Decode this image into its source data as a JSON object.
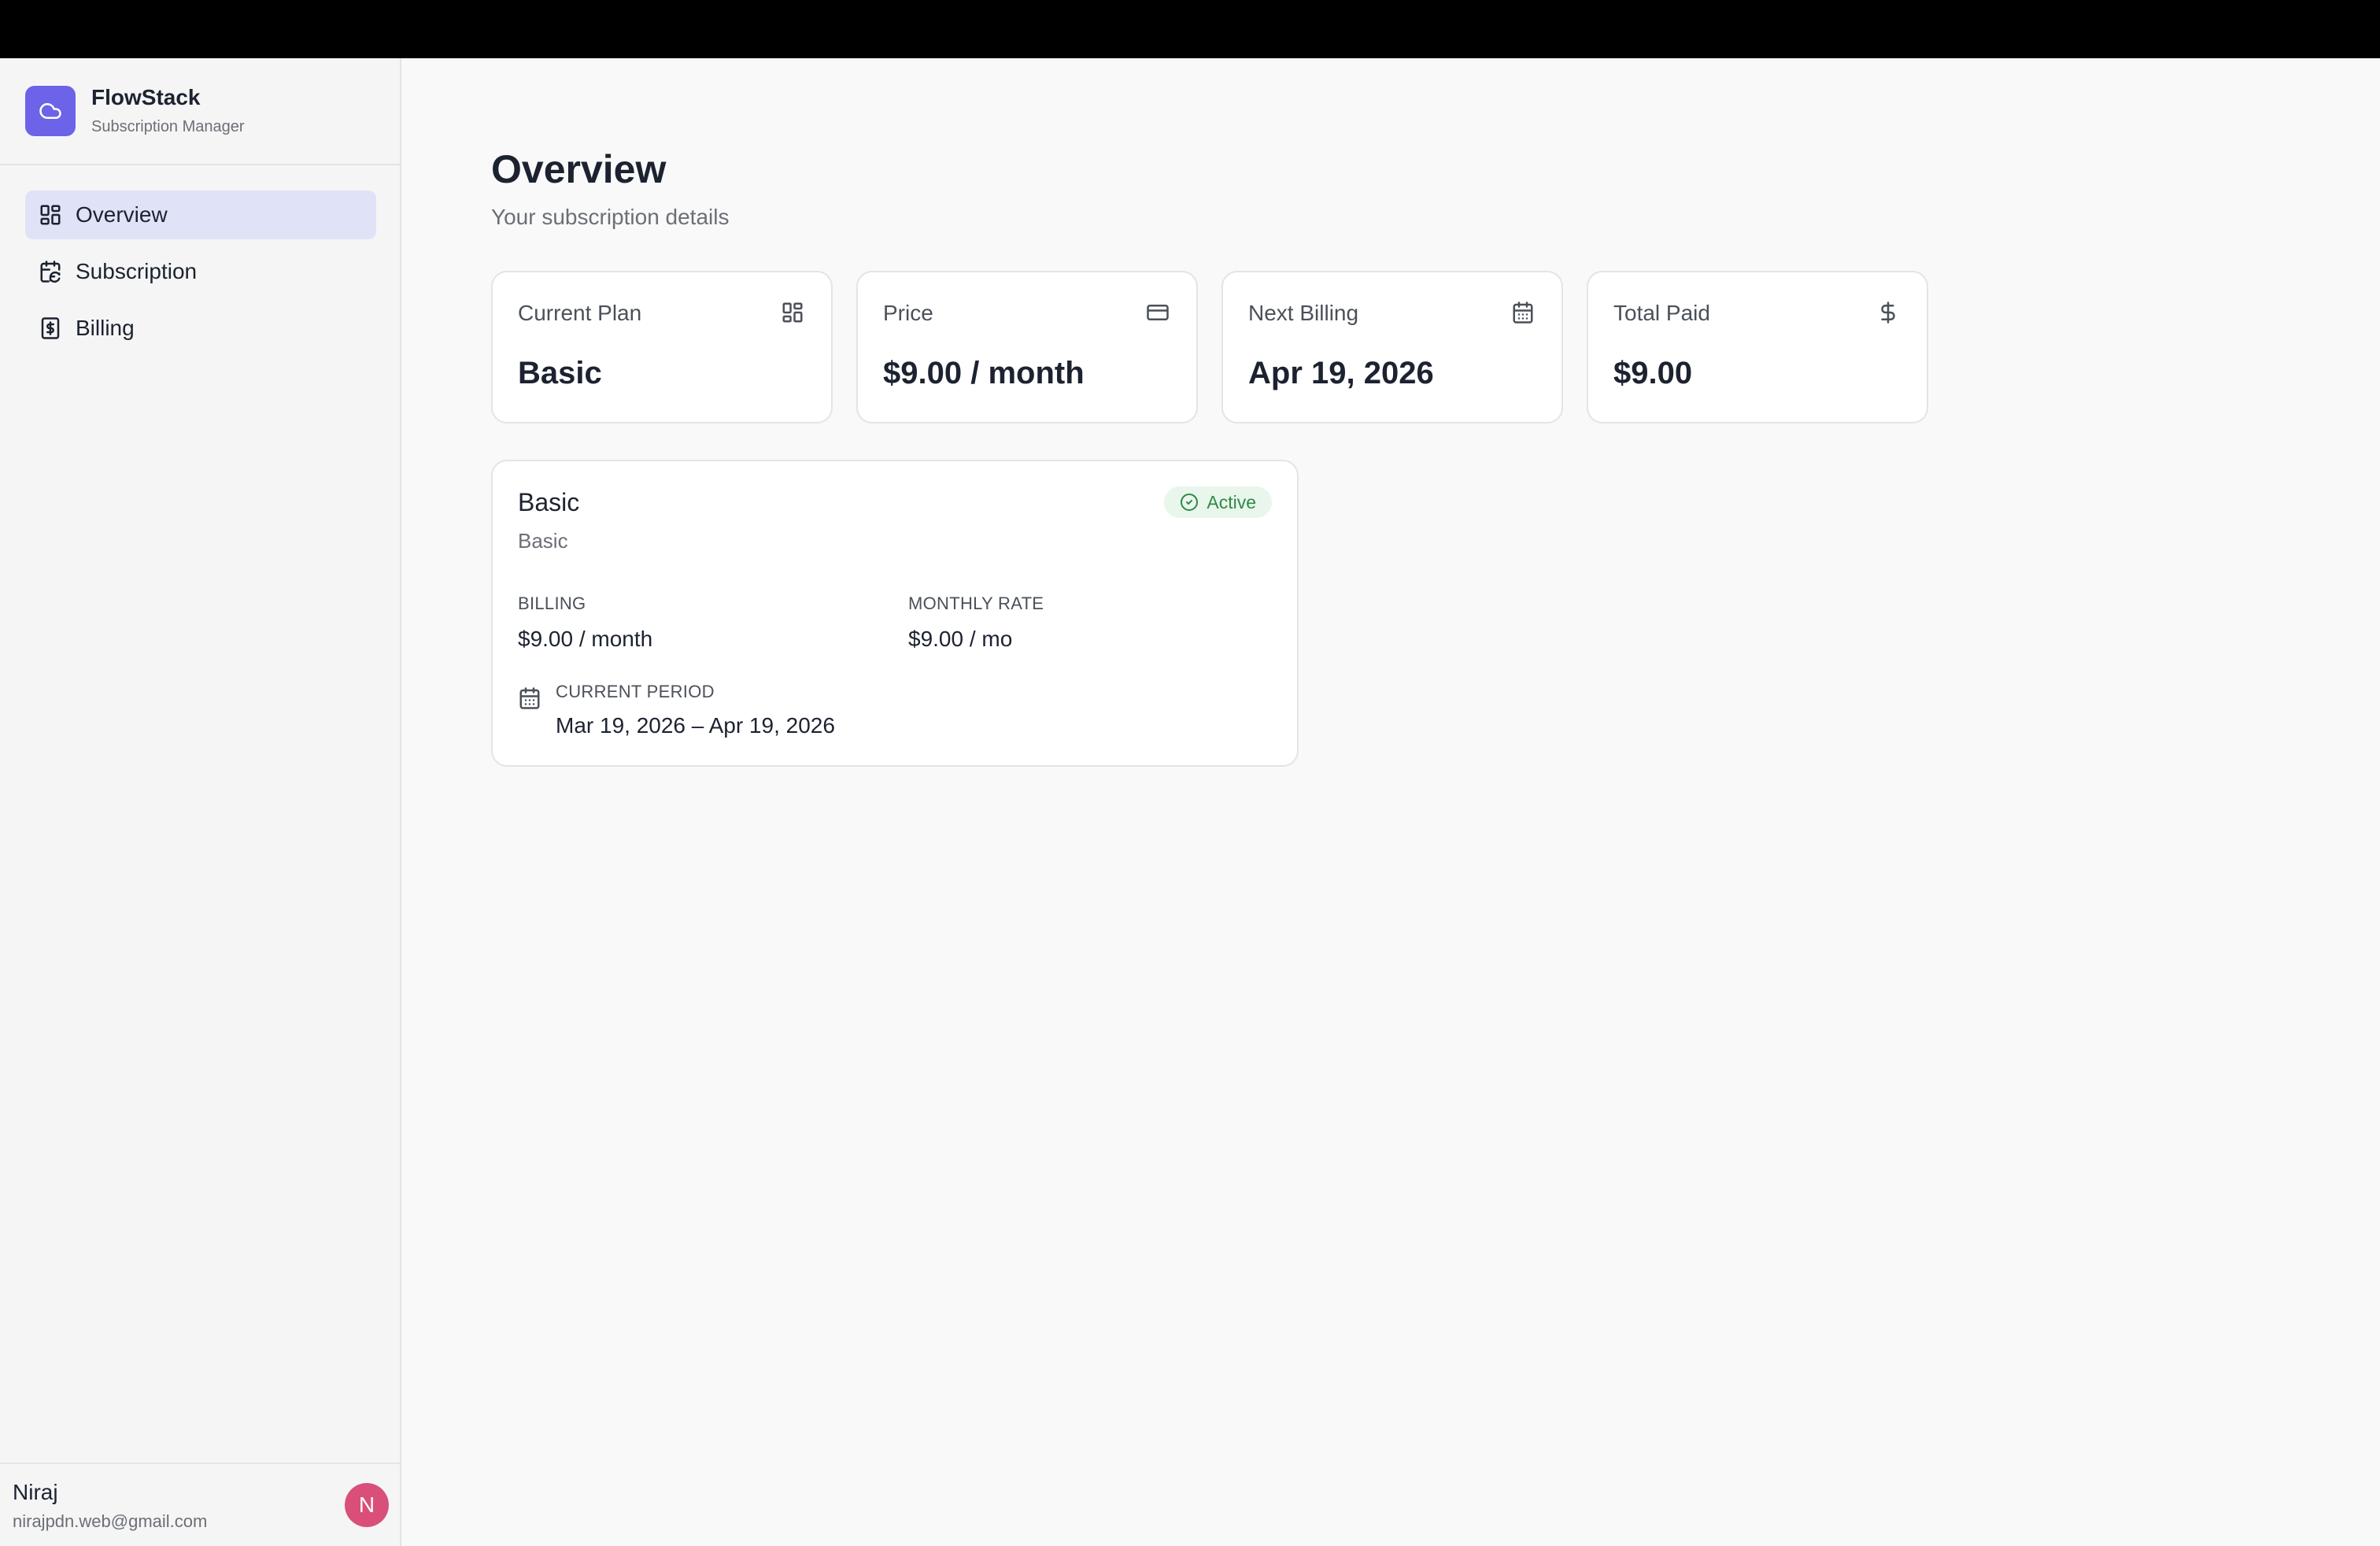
{
  "brand": {
    "name": "FlowStack",
    "subtitle": "Subscription Manager",
    "logo_icon": "cloud-icon",
    "accent": "#6c63e8"
  },
  "nav": {
    "items": [
      {
        "label": "Overview",
        "icon": "dashboard-grid-icon",
        "active": true
      },
      {
        "label": "Subscription",
        "icon": "calendar-refresh-icon",
        "active": false
      },
      {
        "label": "Billing",
        "icon": "receipt-dollar-icon",
        "active": false
      }
    ]
  },
  "user": {
    "name": "Niraj",
    "email": "nirajpdn.web@gmail.com",
    "avatar_initial": "N",
    "avatar_color": "#d94f7a"
  },
  "page": {
    "title": "Overview",
    "subtitle": "Your subscription details"
  },
  "stats": [
    {
      "label": "Current Plan",
      "value": "Basic",
      "icon": "dashboard-grid-icon"
    },
    {
      "label": "Price",
      "value": "$9.00 / month",
      "icon": "credit-card-icon"
    },
    {
      "label": "Next Billing",
      "value": "Apr 19, 2026",
      "icon": "calendar-icon"
    },
    {
      "label": "Total Paid",
      "value": "$9.00",
      "icon": "dollar-icon"
    }
  ],
  "plan": {
    "title": "Basic",
    "subtitle": "Basic",
    "status": "Active",
    "status_color": "#2f8a48",
    "billing_label": "BILLING",
    "billing_value": "$9.00 / month",
    "rate_label": "MONTHLY RATE",
    "rate_value": "$9.00 / mo",
    "period_label": "CURRENT PERIOD",
    "period_value": "Mar 19, 2026 – Apr 19, 2026"
  }
}
